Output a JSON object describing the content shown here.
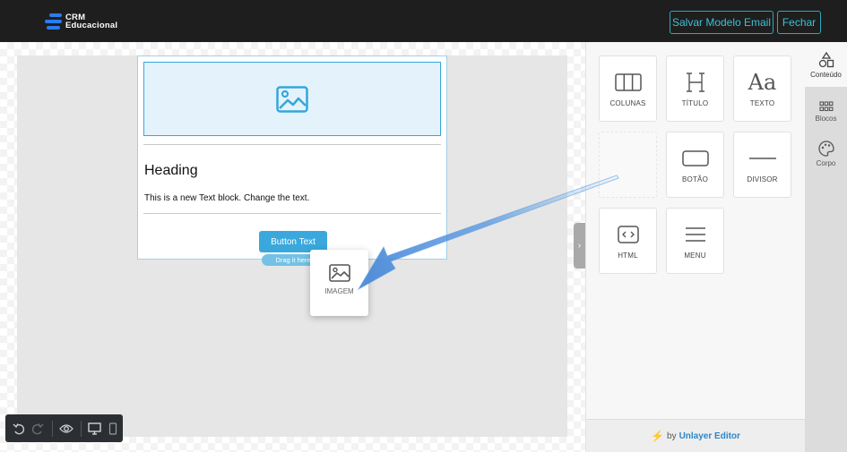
{
  "header": {
    "logo_line1": "CRM",
    "logo_line2": "Educacional",
    "save_label": "Salvar Modelo Email",
    "close_label": "Fechar"
  },
  "canvas": {
    "heading": "Heading",
    "text_block": "This is a new Text block. Change the text.",
    "button_text": "Button Text",
    "drag_hint": "Drag it here",
    "dragged_item_label": "IMAGEM"
  },
  "content_tiles": [
    {
      "label": "COLUNAS",
      "icon": "columns-icon"
    },
    {
      "label": "TÍTULO",
      "icon": "heading-icon"
    },
    {
      "label": "TEXTO",
      "icon": "text-icon"
    },
    {
      "label": "",
      "icon": ""
    },
    {
      "label": "BOTÃO",
      "icon": "button-icon"
    },
    {
      "label": "DIVISOR",
      "icon": "divider-icon"
    },
    {
      "label": "HTML",
      "icon": "code-icon"
    },
    {
      "label": "MENU",
      "icon": "menu-icon"
    }
  ],
  "side_tabs": [
    {
      "label": "Conteúdo",
      "icon": "shapes-icon",
      "active": true
    },
    {
      "label": "Blocos",
      "icon": "grid-icon",
      "active": false
    },
    {
      "label": "Corpo",
      "icon": "palette-icon",
      "active": false
    }
  ],
  "footer": {
    "prefix": "by",
    "brand": "Unlayer Editor"
  },
  "colors": {
    "header_bg": "#1e1e1e",
    "accent_teal": "#3cc1d6",
    "primary_blue": "#3aa8dc",
    "brand_blue": "#2d86c9",
    "bolt": "#f0a020"
  }
}
